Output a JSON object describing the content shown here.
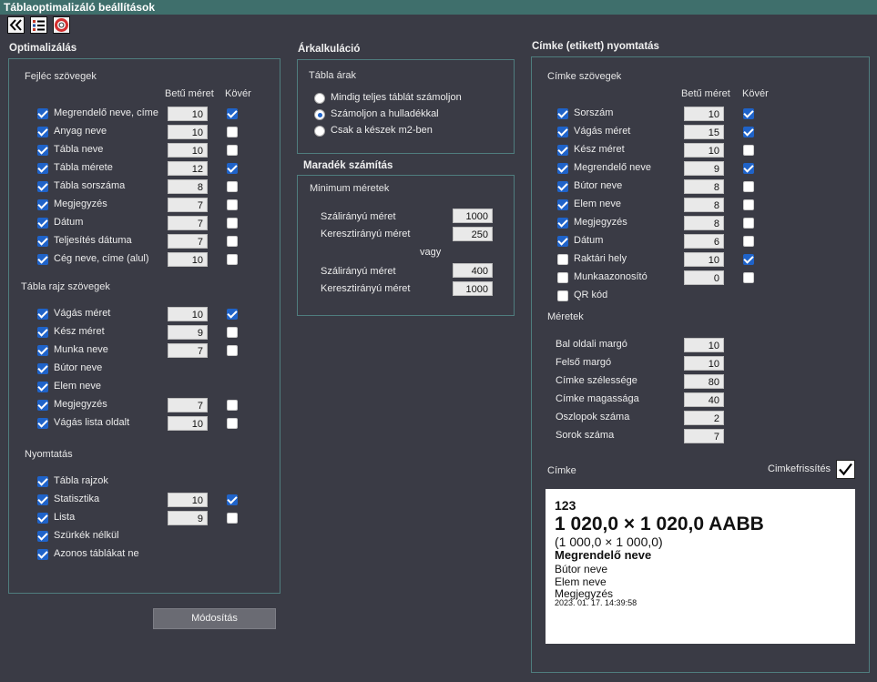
{
  "title": "Táblaoptimalizáló beállítások",
  "toolbar": {
    "icons": [
      "double-chevron-left-icon",
      "list-icon",
      "help-ring-icon"
    ]
  },
  "optimization": {
    "title": "Optimalizálás",
    "header_texts": {
      "title": "Fejléc szövegek",
      "col_size": "Betű méret",
      "col_bold": "Kövér",
      "rows": [
        {
          "label": "Megrendelő neve, címe",
          "checked": true,
          "size": "10",
          "bold": true
        },
        {
          "label": "Anyag neve",
          "checked": true,
          "size": "10",
          "bold": false
        },
        {
          "label": "Tábla neve",
          "checked": true,
          "size": "10",
          "bold": false
        },
        {
          "label": "Tábla mérete",
          "checked": true,
          "size": "12",
          "bold": true
        },
        {
          "label": "Tábla sorszáma",
          "checked": true,
          "size": "8",
          "bold": false
        },
        {
          "label": "Megjegyzés",
          "checked": true,
          "size": "7",
          "bold": false
        },
        {
          "label": "Dátum",
          "checked": true,
          "size": "7",
          "bold": false
        },
        {
          "label": "Teljesítés dátuma",
          "checked": true,
          "size": "7",
          "bold": false
        },
        {
          "label": "Cég neve, címe (alul)",
          "checked": true,
          "size": "10",
          "bold": false
        }
      ]
    },
    "drawing_texts": {
      "title": "Tábla rajz szövegek",
      "rows": [
        {
          "label": "Vágás méret",
          "checked": true,
          "size": "10",
          "bold": true
        },
        {
          "label": "Kész méret",
          "checked": true,
          "size": "9",
          "bold": false
        },
        {
          "label": "Munka neve",
          "checked": true,
          "size": "7",
          "bold": false
        },
        {
          "label": "Bútor neve",
          "checked": true,
          "size": null,
          "bold": null
        },
        {
          "label": "Elem neve",
          "checked": true,
          "size": null,
          "bold": null
        },
        {
          "label": "Megjegyzés",
          "checked": true,
          "size": "7",
          "bold": false
        },
        {
          "label": "Vágás lista oldalt",
          "checked": true,
          "size": "10",
          "bold": false
        }
      ]
    },
    "printing": {
      "title": "Nyomtatás",
      "rows": [
        {
          "label": "Tábla rajzok",
          "checked": true,
          "size": null,
          "bold": null
        },
        {
          "label": "Statisztika",
          "checked": true,
          "size": "10",
          "bold": true
        },
        {
          "label": "Lista",
          "checked": true,
          "size": "9",
          "bold": false
        },
        {
          "label": "Szürkék nélkül",
          "checked": true,
          "size": null,
          "bold": null
        },
        {
          "label": "Azonos táblákat ne",
          "checked": true,
          "size": null,
          "bold": null
        }
      ]
    },
    "modify_button": "Módosítás"
  },
  "pricing": {
    "title": "Árkalkuláció",
    "sub": "Tábla árak",
    "options": [
      {
        "label": "Mindig teljes táblát számoljon",
        "selected": false
      },
      {
        "label": "Számoljon a hulladékkal",
        "selected": true
      },
      {
        "label": "Csak a készek  m2-ben",
        "selected": false
      }
    ]
  },
  "remainder": {
    "title": "Maradék számítás",
    "sub": "Minimum méretek",
    "grain_label_1": "Szálirányú méret",
    "grain_value_1": "1000",
    "cross_label_1": "Keresztirányú méret",
    "cross_value_1": "250",
    "or": "vagy",
    "grain_label_2": "Szálirányú méret",
    "grain_value_2": "400",
    "cross_label_2": "Keresztirányú méret",
    "cross_value_2": "1000"
  },
  "label_print": {
    "title": "Címke (etikett) nyomtatás",
    "texts": {
      "title": "Címke szövegek",
      "col_size": "Betű méret",
      "col_bold": "Kövér",
      "rows": [
        {
          "label": "Sorszám",
          "checked": true,
          "size": "10",
          "bold": true
        },
        {
          "label": "Vágás méret",
          "checked": true,
          "size": "15",
          "bold": true
        },
        {
          "label": "Kész méret",
          "checked": true,
          "size": "10",
          "bold": false
        },
        {
          "label": "Megrendelő neve",
          "checked": true,
          "size": "9",
          "bold": true
        },
        {
          "label": "Bútor neve",
          "checked": true,
          "size": "8",
          "bold": false
        },
        {
          "label": "Elem neve",
          "checked": true,
          "size": "8",
          "bold": false
        },
        {
          "label": "Megjegyzés",
          "checked": true,
          "size": "8",
          "bold": false
        },
        {
          "label": "Dátum",
          "checked": true,
          "size": "6",
          "bold": false
        },
        {
          "label": "Raktári hely",
          "checked": false,
          "size": "10",
          "bold": true
        },
        {
          "label": "Munkaazonosító",
          "checked": false,
          "size": "0",
          "bold": false
        },
        {
          "label": "QR kód",
          "checked": false,
          "size": null,
          "bold": null
        }
      ]
    },
    "sizes": {
      "title": "Méretek",
      "rows": [
        {
          "label": "Bal oldali margó",
          "value": "10"
        },
        {
          "label": "Felső margó",
          "value": "10"
        },
        {
          "label": "Címke szélessége",
          "value": "80"
        },
        {
          "label": "Címke magassága",
          "value": "40"
        },
        {
          "label": "Oszlopok száma",
          "value": "2"
        },
        {
          "label": "Sorok száma",
          "value": "7"
        }
      ]
    },
    "preview_title": "Címke",
    "refresh_label": "Cimkefrissítés",
    "refresh_checked": true,
    "preview": {
      "line1": "123",
      "line2": "1 020,0 × 1 020,0 AABB",
      "line3": "(1 000,0 × 1 000,0)",
      "line4": "Megrendelő neve",
      "line5": "Bútor neve",
      "line6": "Elem neve",
      "line7": "Megjegyzés",
      "line8": "2023. 01. 17. 14:39:58"
    }
  }
}
